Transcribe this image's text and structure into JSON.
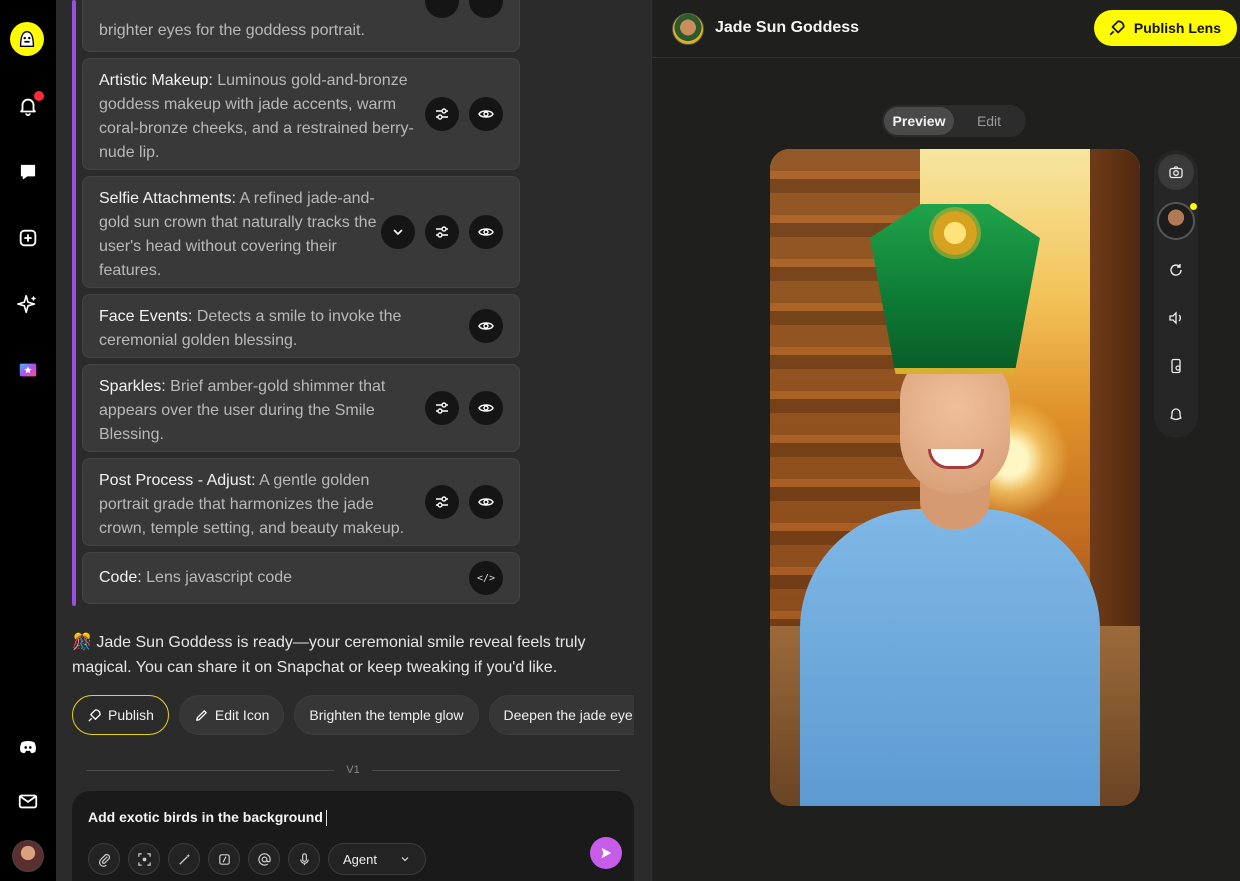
{
  "rail": {
    "items": [
      "logo-icon",
      "bell-icon",
      "chat-icon",
      "add-icon",
      "sparkle-icon",
      "lens-icon",
      "discord-icon",
      "mail-icon"
    ]
  },
  "cards": [
    {
      "title": "",
      "text": "brighter eyes for the goddess portrait."
    },
    {
      "title": "Artistic Makeup:",
      "text": " Luminous gold-and-bronze goddess makeup with jade accents, warm coral-bronze cheeks, and a restrained berry-nude lip."
    },
    {
      "title": "Selfie Attachments:",
      "text": " A refined jade-and-gold sun crown that naturally tracks the user's head without covering their features."
    },
    {
      "title": "Face Events:",
      "text": " Detects a smile to invoke the ceremonial golden blessing."
    },
    {
      "title": "Sparkles:",
      "text": " Brief amber-gold shimmer that appears over the user during the Smile Blessing."
    },
    {
      "title": "Post Process - Adjust:",
      "text": " A gentle golden portrait grade that harmonizes the jade crown, temple setting, and beauty makeup."
    },
    {
      "title": "Code:",
      "text": " Lens javascript code"
    }
  ],
  "code_glyph": "</>",
  "ready_message": "🎊 Jade Sun Goddess is ready—your ceremonial smile reveal feels truly magical. You can share it on Snapchat or keep tweaking if you'd like.",
  "chips": {
    "publish": "Publish",
    "edit_icon": "Edit Icon",
    "suggestion_1": "Brighten the temple glow",
    "suggestion_2": "Deepen the jade eye colo"
  },
  "version": "V1",
  "composer": {
    "value": "Add exotic birds in the background",
    "agent_label": "Agent"
  },
  "preview": {
    "lens_title": "Jade Sun Goddess",
    "publish_label": "Publish Lens",
    "toggle": {
      "preview": "Preview",
      "edit": "Edit"
    }
  },
  "colors": {
    "accent_purple": "#9b4fe0",
    "snap_yellow": "#fffc00",
    "send_button": "#c65ce8",
    "notification": "#ff2a3a"
  }
}
